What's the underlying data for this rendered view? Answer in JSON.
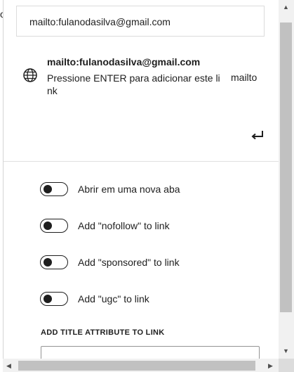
{
  "stray_char": "o",
  "url_input": {
    "value": "mailto:fulanodasilva@gmail.com"
  },
  "suggestion": {
    "title": "mailto:fulanodasilva@gmail.com",
    "description": "Pressione ENTER para adicionar este link",
    "type": "mailto",
    "icon": "globe-icon",
    "enter_icon": "enter-return-icon"
  },
  "toggles": [
    {
      "label": "Abrir em uma nova aba",
      "checked": false
    },
    {
      "label": "Add \"nofollow\" to link",
      "checked": false
    },
    {
      "label": "Add \"sponsored\" to link",
      "checked": false
    },
    {
      "label": "Add \"ugc\" to link",
      "checked": false
    }
  ],
  "title_attribute": {
    "label": "ADD TITLE ATTRIBUTE TO LINK",
    "value": ""
  }
}
